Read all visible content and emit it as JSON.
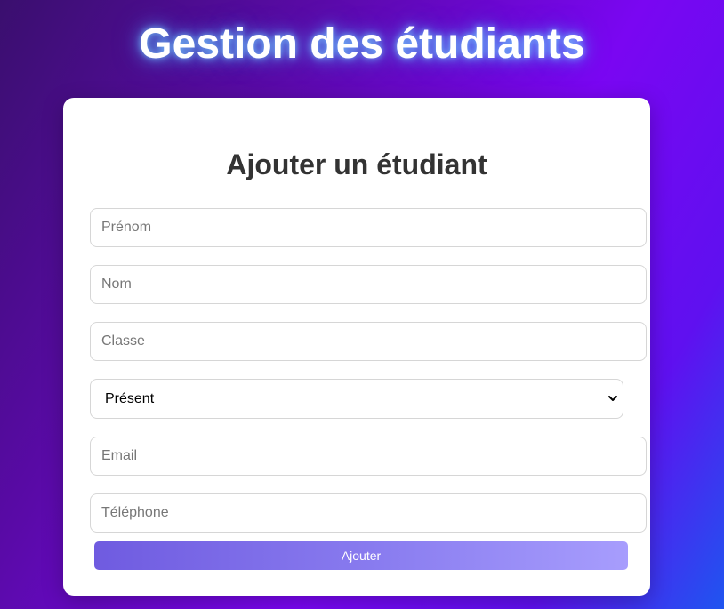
{
  "page": {
    "title": "Gestion des étudiants"
  },
  "form": {
    "title": "Ajouter un étudiant",
    "fields": {
      "prenom": {
        "placeholder": "Prénom",
        "value": ""
      },
      "nom": {
        "placeholder": "Nom",
        "value": ""
      },
      "classe": {
        "placeholder": "Classe",
        "value": ""
      },
      "email": {
        "placeholder": "Email",
        "value": ""
      },
      "telephone": {
        "placeholder": "Téléphone",
        "value": ""
      }
    },
    "status_select": {
      "selected": "Présent",
      "icon": "chevron-down-icon"
    },
    "submit_label": "Ajouter"
  },
  "colors": {
    "background_start": "#3a0f6e",
    "background_mid": "#7a06f2",
    "background_end": "#1f55f0",
    "title_glow": "#50aaff",
    "button_start": "#6f5be0",
    "button_end": "#a79dfd",
    "card": "#ffffff"
  }
}
